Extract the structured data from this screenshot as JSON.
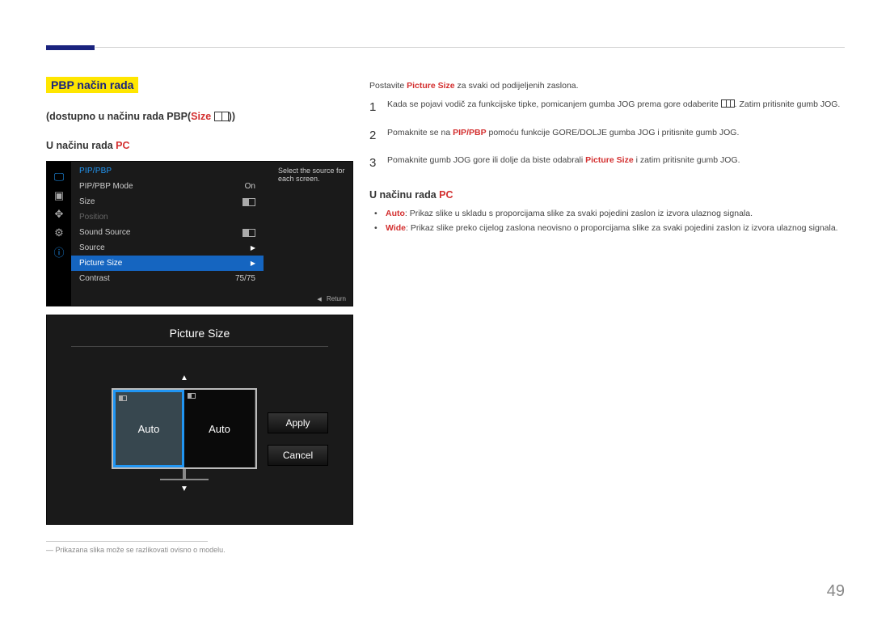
{
  "section_title": "PBP način rada",
  "subheading_prefix": "(dostupno u načinu rada PBP(",
  "subheading_size": "Size",
  "subheading_suffix": "))",
  "mode_heading_prefix": "U načinu rada ",
  "mode_heading_pc": "PC",
  "osd": {
    "heading": "PIP/PBP",
    "rows": {
      "mode": {
        "label": "PIP/PBP Mode",
        "value": "On"
      },
      "size": {
        "label": "Size"
      },
      "position": {
        "label": "Position"
      },
      "sound": {
        "label": "Sound Source"
      },
      "source": {
        "label": "Source"
      },
      "picturesize": {
        "label": "Picture Size"
      },
      "contrast": {
        "label": "Contrast",
        "value": "75/75"
      }
    },
    "help": "Select the source for each screen.",
    "return": "Return"
  },
  "picsize": {
    "title": "Picture Size",
    "left_label": "Auto",
    "right_label": "Auto",
    "apply": "Apply",
    "cancel": "Cancel"
  },
  "footnote_marker": "―",
  "footnote": "Prikazana slika može se razlikovati ovisno o modelu.",
  "intro_prefix": "Postavite ",
  "intro_bold": "Picture Size",
  "intro_suffix": " za svaki od podijeljenih zaslona.",
  "steps": {
    "s1a": "Kada se pojavi vodič za funkcijske tipke, pomicanjem gumba JOG prema gore odaberite ",
    "s1b": ". Zatim pritisnite gumb JOG.",
    "s2a": "Pomaknite se na ",
    "s2b": "PIP/PBP",
    "s2c": " pomoću funkcije GORE/DOLJE gumba JOG i pritisnite gumb JOG.",
    "s3a": "Pomaknite gumb JOG gore ili dolje da biste odabrali ",
    "s3b": "Picture Size",
    "s3c": " i zatim pritisnite gumb JOG."
  },
  "bullets": {
    "auto_label": "Auto",
    "auto_text": ": Prikaz slike u skladu s proporcijama slike za svaki pojedini zaslon iz izvora ulaznog signala.",
    "wide_label": "Wide",
    "wide_text": ": Prikaz slike preko cijelog zaslona neovisno o proporcijama slike za svaki pojedini zaslon iz izvora ulaznog signala."
  },
  "page_no": "49"
}
